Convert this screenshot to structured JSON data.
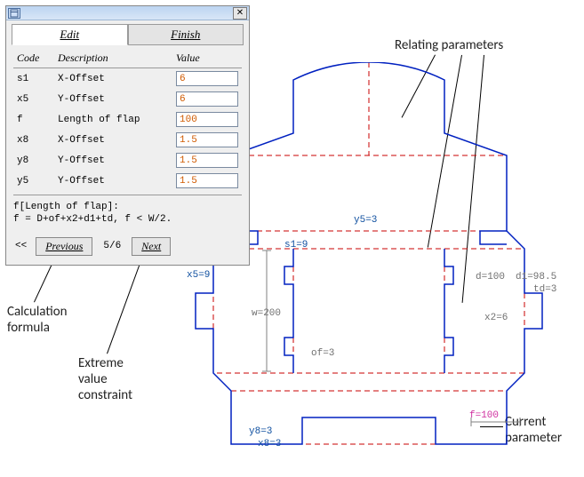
{
  "dialog": {
    "tabs": {
      "edit": "Edit",
      "finish": "Finish"
    },
    "headers": {
      "code": "Code",
      "desc": "Description",
      "value": "Value"
    },
    "rows": [
      {
        "code": "s1",
        "desc": "X-Offset",
        "value": "6"
      },
      {
        "code": "x5",
        "desc": "Y-Offset",
        "value": "6"
      },
      {
        "code": "f",
        "desc": "Length of flap",
        "value": "100"
      },
      {
        "code": "x8",
        "desc": "X-Offset",
        "value": "1.5"
      },
      {
        "code": "y8",
        "desc": "Y-Offset",
        "value": "1.5"
      },
      {
        "code": "y5",
        "desc": "Y-Offset",
        "value": "1.5"
      }
    ],
    "formula_title": "f[Length of flap]:",
    "formula_body": "f = D+of+x2+d1+td, f < W/2.",
    "nav": {
      "first": "<<",
      "prev": "Previous",
      "page": "5/6",
      "next": "Next"
    },
    "close": "✕"
  },
  "annotations": {
    "relating": "Relating parameters",
    "calc": "Calculation\nformula",
    "extreme": "Extreme\nvalue\nconstraint",
    "current": "Current\nparameter"
  },
  "drawing_labels": {
    "y5": "y5=3",
    "s1": "s1=9",
    "x5": "x5=9",
    "d": "d=100",
    "d1": "d1=98.5",
    "td": "td=3",
    "w": "w=200",
    "x2": "x2=6",
    "of": "of=3",
    "f": "f=100",
    "y8": "y8=3",
    "x8": "x8=3"
  }
}
